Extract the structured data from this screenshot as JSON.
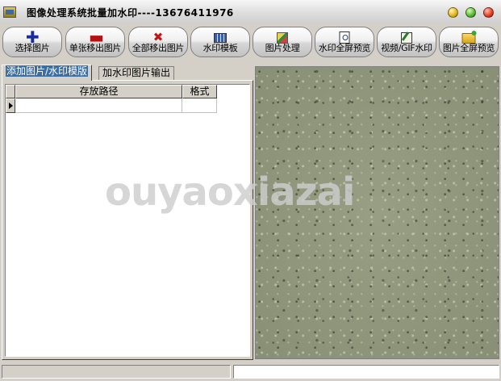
{
  "window": {
    "title": "图像处理系统批量加水印----13676411976"
  },
  "toolbar": {
    "buttons": [
      {
        "label": "选择图片",
        "icon": "plus-icon"
      },
      {
        "label": "单张移出图片",
        "icon": "minus-icon"
      },
      {
        "label": "全部移出图片",
        "icon": "x-icon"
      },
      {
        "label": "水印模板",
        "icon": "template-icon"
      },
      {
        "label": "图片处理",
        "icon": "paint-icon"
      },
      {
        "label": "水印全屏预览",
        "icon": "preview-icon"
      },
      {
        "label": "视频/GIF水印",
        "icon": "video-edit-icon"
      },
      {
        "label": "图片全屏预览",
        "icon": "folder-open-icon"
      }
    ]
  },
  "tabs": [
    {
      "label": "添加图片/水印模版",
      "active": true
    },
    {
      "label": "加水印图片输出",
      "active": false
    }
  ],
  "grid": {
    "columns": [
      "存放路径",
      "格式"
    ],
    "rows": [
      [
        "",
        ""
      ]
    ]
  },
  "watermark": {
    "text": "ouyaoxiazai"
  }
}
